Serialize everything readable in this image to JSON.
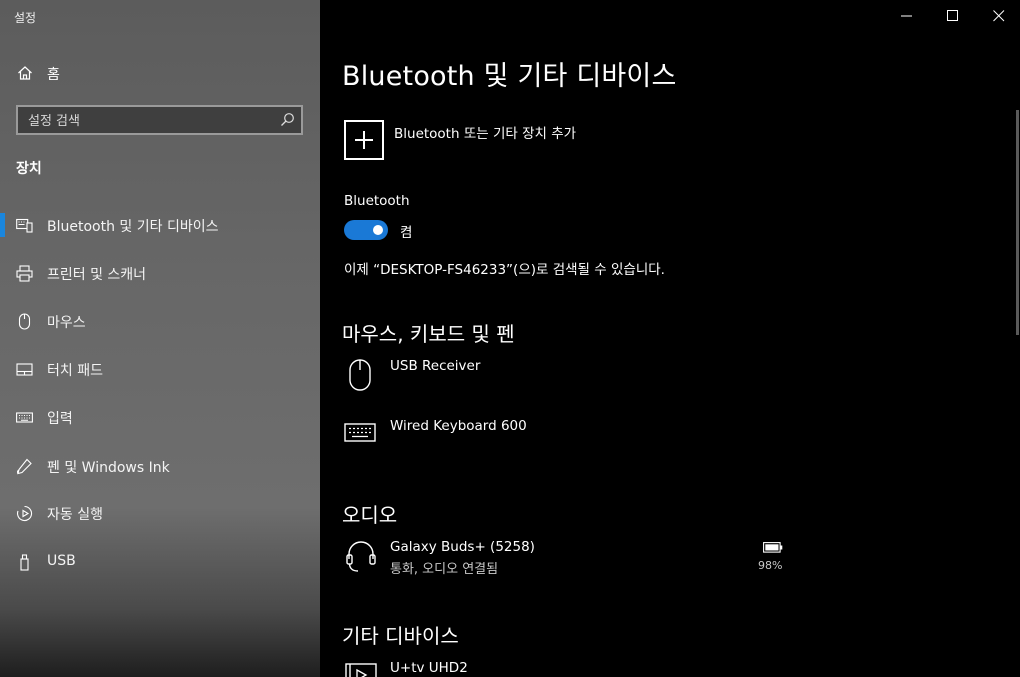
{
  "app": {
    "title": "설정"
  },
  "sidebar": {
    "home_label": "홈",
    "search_placeholder": "설정 검색",
    "section_title": "장치",
    "items": [
      {
        "label": "Bluetooth 및 기타 디바이스",
        "icon": "bluetooth-devices-icon",
        "active": true
      },
      {
        "label": "프린터 및 스캐너",
        "icon": "printer-icon"
      },
      {
        "label": "마우스",
        "icon": "mouse-icon"
      },
      {
        "label": "터치 패드",
        "icon": "touchpad-icon"
      },
      {
        "label": "입력",
        "icon": "keyboard-icon"
      },
      {
        "label": "펜 및 Windows Ink",
        "icon": "pen-icon"
      },
      {
        "label": "자동 실행",
        "icon": "autoplay-icon"
      },
      {
        "label": "USB",
        "icon": "usb-icon"
      }
    ]
  },
  "main": {
    "title": "Bluetooth 및 기타 디바이스",
    "add_label": "Bluetooth 또는 기타 장치 추가",
    "bluetooth_label": "Bluetooth",
    "toggle_state": "켬",
    "discoverable_text": "이제 “DESKTOP-FS46233”(으)로 검색될 수 있습니다.",
    "groups": {
      "input": {
        "title": "마우스, 키보드 및 펜",
        "devices": [
          {
            "name": "USB Receiver",
            "icon": "mouse-icon"
          },
          {
            "name": "Wired Keyboard 600",
            "icon": "keyboard-icon"
          }
        ]
      },
      "audio": {
        "title": "오디오",
        "devices": [
          {
            "name": "Galaxy Buds+ (5258)",
            "status": "통화, 오디오 연결됨",
            "battery": "98%",
            "icon": "headset-icon"
          }
        ]
      },
      "other": {
        "title": "기타 디바이스",
        "devices": [
          {
            "name": "U+tv UHD2",
            "icon": "media-device-icon"
          }
        ]
      }
    }
  },
  "colors": {
    "accent": "#1a79d6",
    "background": "#000000",
    "sidebar": "#666666"
  }
}
